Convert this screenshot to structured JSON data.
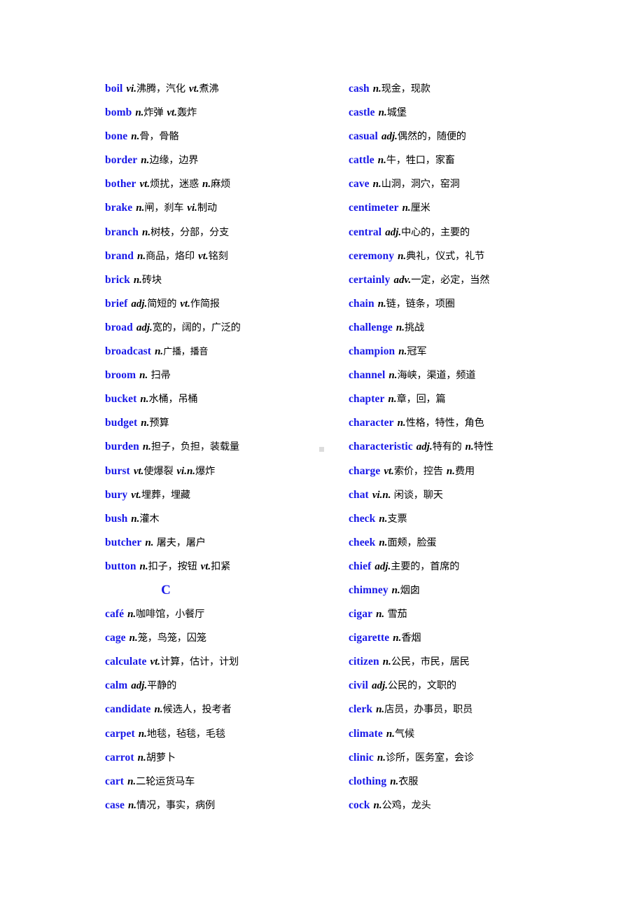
{
  "document": {
    "type": "vocabulary-glossary",
    "page_background": "#ffffff",
    "word_color": "#1818e8",
    "text_color": "#000000",
    "marker_color": "#dcdcdc",
    "columns": 2
  },
  "left_column": [
    {
      "word": "boil",
      "parts": [
        {
          "pos": "vi.",
          "def": "沸腾，汽化"
        },
        {
          "pos": "vt.",
          "def": "煮沸"
        }
      ]
    },
    {
      "word": "bomb",
      "parts": [
        {
          "pos": "n.",
          "def": "炸弹"
        },
        {
          "pos": "vt.",
          "def": "轰炸"
        }
      ]
    },
    {
      "word": "bone",
      "parts": [
        {
          "pos": "n.",
          "def": "骨，骨骼"
        }
      ]
    },
    {
      "word": "border",
      "parts": [
        {
          "pos": "n.",
          "def": "边缘，边界"
        }
      ]
    },
    {
      "word": "bother",
      "parts": [
        {
          "pos": "vt.",
          "def": "烦扰，迷惑"
        },
        {
          "pos": "n.",
          "def": "麻烦"
        }
      ]
    },
    {
      "word": "brake",
      "parts": [
        {
          "pos": "n.",
          "def": "闸，刹车"
        },
        {
          "pos": "vi.",
          "def": "制动"
        }
      ]
    },
    {
      "word": "branch",
      "parts": [
        {
          "pos": "n.",
          "def": "树枝，分部，分支"
        }
      ]
    },
    {
      "word": "brand",
      "parts": [
        {
          "pos": "n.",
          "def": "商品，烙印"
        },
        {
          "pos": "vt.",
          "def": "铭刻"
        }
      ]
    },
    {
      "word": "brick",
      "parts": [
        {
          "pos": "n.",
          "def": "砖块"
        }
      ]
    },
    {
      "word": "brief",
      "parts": [
        {
          "pos": "adj.",
          "def": "简短的"
        },
        {
          "pos": "vt.",
          "def": "作简报"
        }
      ]
    },
    {
      "word": "broad",
      "parts": [
        {
          "pos": "adj.",
          "def": "宽的，阔的，广泛的"
        }
      ]
    },
    {
      "word": "broadcast",
      "parts": [
        {
          "pos": "n.",
          "def": "广播，播音",
          "small": true
        }
      ]
    },
    {
      "word": "broom",
      "parts": [
        {
          "pos": "n.",
          "def": " 扫帚"
        }
      ]
    },
    {
      "word": "bucket",
      "parts": [
        {
          "pos": "n.",
          "def": "水桶，吊桶"
        }
      ]
    },
    {
      "word": "budget",
      "parts": [
        {
          "pos": "n.",
          "def": "预算"
        }
      ]
    },
    {
      "word": "burden",
      "parts": [
        {
          "pos": "n.",
          "def": "担子，负担，装载量"
        }
      ]
    },
    {
      "word": "burst",
      "parts": [
        {
          "pos": "vt.",
          "def": "使爆裂"
        },
        {
          "pos": "vi.n.",
          "def": "爆炸"
        }
      ]
    },
    {
      "word": "bury",
      "parts": [
        {
          "pos": "vt.",
          "def": "埋葬，埋藏"
        }
      ]
    },
    {
      "word": "bush",
      "parts": [
        {
          "pos": "n.",
          "def": "灌木"
        }
      ]
    },
    {
      "word": "butcher",
      "parts": [
        {
          "pos": "n.",
          "def": " 屠夫，屠户"
        }
      ]
    },
    {
      "word": "button",
      "parts": [
        {
          "pos": "n.",
          "def": "扣子，按钮"
        },
        {
          "pos": "vt.",
          "def": "扣紧"
        }
      ]
    },
    {
      "section": "C"
    },
    {
      "word": "café",
      "parts": [
        {
          "pos": "n.",
          "def": "咖啡馆，小餐厅"
        }
      ]
    },
    {
      "word": "cage",
      "parts": [
        {
          "pos": "n.",
          "def": "笼，鸟笼，囚笼"
        }
      ]
    },
    {
      "word": "calculate",
      "parts": [
        {
          "pos": "vt.",
          "def": "计算，估计，计划"
        }
      ]
    },
    {
      "word": "calm",
      "parts": [
        {
          "pos": "adj.",
          "def": "平静的"
        }
      ]
    },
    {
      "word": "candidate",
      "parts": [
        {
          "pos": "n.",
          "def": "候选人，投考者"
        }
      ]
    },
    {
      "word": "carpet",
      "parts": [
        {
          "pos": "n.",
          "def": "地毯，毡毯，毛毯"
        }
      ]
    },
    {
      "word": "carrot",
      "parts": [
        {
          "pos": "n.",
          "def": "胡萝卜"
        }
      ]
    },
    {
      "word": "cart",
      "parts": [
        {
          "pos": "n.",
          "def": "二轮运货马车"
        }
      ]
    },
    {
      "word": "case",
      "parts": [
        {
          "pos": "n.",
          "def": "情况，事实，病例"
        }
      ]
    }
  ],
  "right_column": [
    {
      "word": "cash",
      "parts": [
        {
          "pos": "n.",
          "def": "现金，现款"
        }
      ]
    },
    {
      "word": "castle",
      "parts": [
        {
          "pos": "n.",
          "def": "城堡"
        }
      ]
    },
    {
      "word": "casual",
      "parts": [
        {
          "pos": "adj.",
          "def": "偶然的，随便的"
        }
      ]
    },
    {
      "word": "cattle",
      "parts": [
        {
          "pos": "n.",
          "def": "牛，牲口，家畜"
        }
      ]
    },
    {
      "word": "cave",
      "parts": [
        {
          "pos": "n.",
          "def": "山洞，洞穴，窑洞"
        }
      ]
    },
    {
      "word": "centimeter",
      "parts": [
        {
          "pos": "n.",
          "def": "厘米"
        }
      ]
    },
    {
      "word": "central",
      "parts": [
        {
          "pos": "adj.",
          "def": "中心的，主要的"
        }
      ]
    },
    {
      "word": "ceremony",
      "parts": [
        {
          "pos": "n.",
          "def": "典礼，仪式，礼节"
        }
      ]
    },
    {
      "word": "certainly",
      "parts": [
        {
          "pos": "adv.",
          "def": "一定，必定，当然"
        }
      ]
    },
    {
      "word": "chain",
      "parts": [
        {
          "pos": "n.",
          "def": "链，链条，项圈"
        }
      ]
    },
    {
      "word": "challenge",
      "parts": [
        {
          "pos": "n.",
          "def": "挑战"
        }
      ]
    },
    {
      "word": "champion",
      "parts": [
        {
          "pos": "n.",
          "def": "冠军"
        }
      ]
    },
    {
      "word": "channel",
      "parts": [
        {
          "pos": "n.",
          "def": "海峡，渠道，频道"
        }
      ]
    },
    {
      "word": "chapter",
      "parts": [
        {
          "pos": "n.",
          "def": "章，回，篇"
        }
      ]
    },
    {
      "word": "character",
      "parts": [
        {
          "pos": "n.",
          "def": "性格，特性，角色"
        }
      ]
    },
    {
      "word": "characteristic",
      "parts": [
        {
          "pos": "adj.",
          "def": "特有的"
        },
        {
          "pos": "n.",
          "def": "特性"
        }
      ]
    },
    {
      "word": "charge",
      "parts": [
        {
          "pos": "vt.",
          "def": "索价，控告"
        },
        {
          "pos": "n.",
          "def": "费用"
        }
      ]
    },
    {
      "word": "chat",
      "parts": [
        {
          "pos": "vi.n.",
          "def": " 闲谈，聊天"
        }
      ]
    },
    {
      "word": "check",
      "parts": [
        {
          "pos": "n.",
          "def": "支票"
        }
      ]
    },
    {
      "word": "cheek",
      "parts": [
        {
          "pos": "n.",
          "def": "面颊，脸蛋"
        }
      ]
    },
    {
      "word": "chief",
      "parts": [
        {
          "pos": "adj.",
          "def": "主要的，首席的"
        }
      ]
    },
    {
      "word": "chimney",
      "parts": [
        {
          "pos": "n.",
          "def": "烟囱"
        }
      ]
    },
    {
      "word": "cigar",
      "parts": [
        {
          "pos": "n.",
          "def": " 雪茄"
        }
      ]
    },
    {
      "word": "cigarette",
      "parts": [
        {
          "pos": "n.",
          "def": "香烟"
        }
      ]
    },
    {
      "word": "citizen",
      "parts": [
        {
          "pos": "n.",
          "def": "公民，市民，居民"
        }
      ]
    },
    {
      "word": "civil",
      "parts": [
        {
          "pos": "adj.",
          "def": "公民的，文职的"
        }
      ]
    },
    {
      "word": "clerk",
      "parts": [
        {
          "pos": "n.",
          "def": "店员，办事员，职员"
        }
      ]
    },
    {
      "word": "climate",
      "parts": [
        {
          "pos": "n.",
          "def": "气候"
        }
      ]
    },
    {
      "word": "clinic",
      "parts": [
        {
          "pos": "n.",
          "def": "诊所，医务室，会诊"
        }
      ]
    },
    {
      "word": "clothing",
      "parts": [
        {
          "pos": "n.",
          "def": "衣服"
        }
      ]
    },
    {
      "word": "cock",
      "parts": [
        {
          "pos": "n.",
          "def": "公鸡，龙头"
        }
      ]
    }
  ]
}
